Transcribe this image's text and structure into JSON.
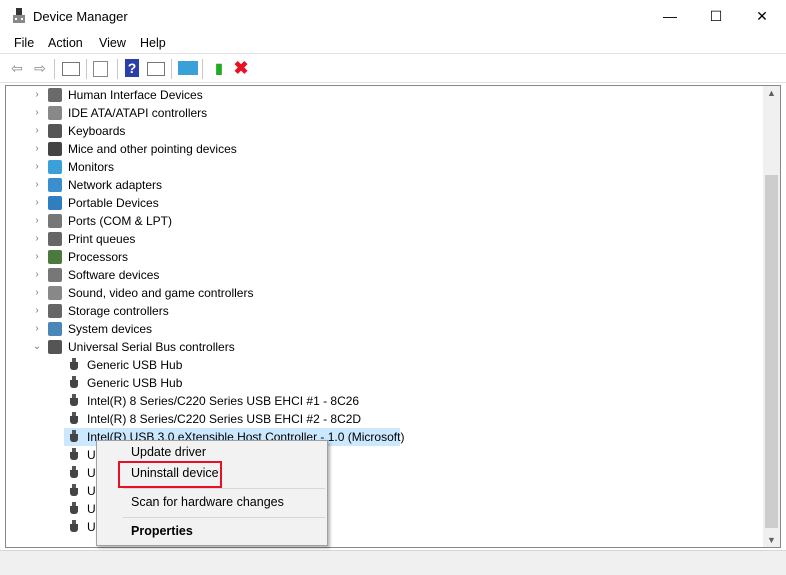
{
  "window": {
    "title": "Device Manager",
    "minimize": "—",
    "maximize": "☐",
    "close": "✕"
  },
  "menu": [
    "File",
    "Action",
    "View",
    "Help"
  ],
  "toolbar": {
    "icons": [
      "back-icon",
      "forward-icon",
      "show-hide-console-tree-icon",
      "properties-icon",
      "help-icon",
      "action-pane-icon",
      "scan-hardware-icon",
      "update-driver-icon",
      "uninstall-icon"
    ]
  },
  "tree": {
    "categories": [
      "Human Interface Devices",
      "IDE ATA/ATAPI controllers",
      "Keyboards",
      "Mice and other pointing devices",
      "Monitors",
      "Network adapters",
      "Portable Devices",
      "Ports (COM & LPT)",
      "Print queues",
      "Processors",
      "Software devices",
      "Sound, video and game controllers",
      "Storage controllers",
      "System devices",
      "Universal Serial Bus controllers"
    ],
    "usb_children": [
      "Generic USB Hub",
      "Generic USB Hub",
      "Intel(R) 8 Series/C220 Series USB EHCI #1 - 8C26",
      "Intel(R) 8 Series/C220 Series USB EHCI #2 - 8C2D",
      "Intel(R) USB 3.0 eXtensible Host Controller - 1.0 (Microsoft)",
      "U",
      "U",
      "U",
      "U",
      "U"
    ],
    "selected_index": 4
  },
  "context_menu": {
    "items": [
      "Update driver",
      "Uninstall device",
      "Scan for hardware changes",
      "Properties"
    ],
    "highlighted": "Uninstall device"
  },
  "colors": {
    "selection": "#cce8ff",
    "highlight_box": "#e81123"
  }
}
